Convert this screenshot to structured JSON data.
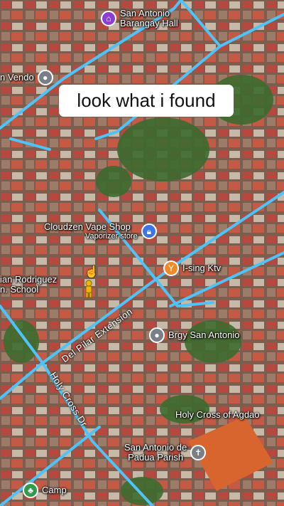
{
  "caption": "look what i found",
  "colors": {
    "road": "#4fc3f7",
    "roof_red": "#b5493f",
    "tree": "#3d6b2f",
    "place_pin": "#8a3fd1",
    "shop_pin": "#3d74e6",
    "bar_pin": "#f08a24",
    "gov_pin": "#7a7f87",
    "church_pin": "#7a7f87",
    "park_pin": "#2e9c4a"
  },
  "places": {
    "barangay_hall": {
      "name": "San Antonio",
      "name2": "Barangay Hall",
      "icon": "building-icon"
    },
    "vendo": {
      "name": "n Vendo",
      "icon": "pin-icon"
    },
    "vape_shop": {
      "name": "Cloudzen Vape Shop",
      "sub": "Vaporizer store",
      "icon": "shopping-bag-icon"
    },
    "school": {
      "name": "ian Rodriguez",
      "name2": "n. School"
    },
    "bar": {
      "name": "I-sing Ktv",
      "icon": "cocktail-icon"
    },
    "brgy": {
      "name": "Brgy San Antonio",
      "icon": "pin-icon"
    },
    "holy_cross": {
      "name": "Holy Cross of Agdao"
    },
    "parish": {
      "name": "San Antonio de",
      "name2": "Padua Parish",
      "icon": "cross-icon"
    },
    "camp": {
      "name": "Camp",
      "icon": "tree-icon"
    }
  },
  "streets": {
    "del_pilar": "Del Pilar Extension",
    "holy_cross_dr": "Holy Cross Dr"
  }
}
